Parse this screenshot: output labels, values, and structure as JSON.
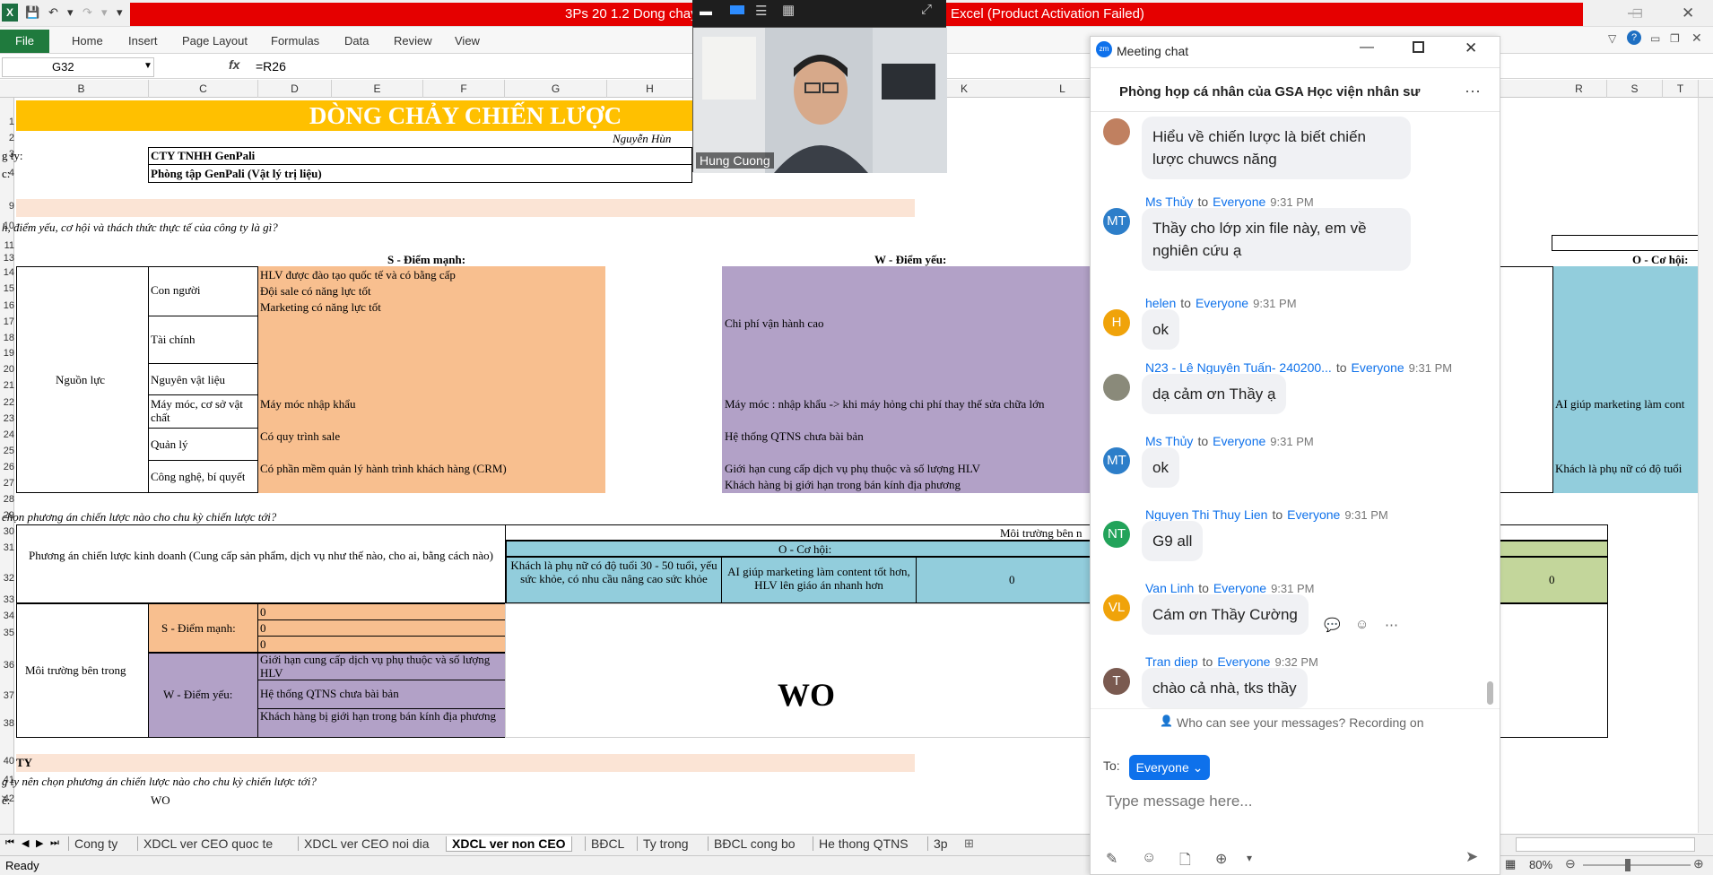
{
  "window": {
    "title": "3Ps 20 1.2 Dong chay chien luoc - Microsoft Excel (Product Activation Failed)",
    "title_left": "3Ps 20 1.2 Dong chay",
    "title_right": "Excel (Product Activation Failed)"
  },
  "ribbon": {
    "file": "File",
    "tabs": [
      "Home",
      "Insert",
      "Page Layout",
      "Formulas",
      "Data",
      "Review",
      "View"
    ]
  },
  "formula_bar": {
    "name_box": "G32",
    "fx": "fx",
    "formula": "=R26"
  },
  "columns": [
    "B",
    "C",
    "D",
    "E",
    "F",
    "G",
    "H",
    "K",
    "L",
    "R",
    "S",
    "T"
  ],
  "rows": [
    "1",
    "2",
    "3",
    "4",
    "9",
    "10",
    "11",
    "13",
    "14",
    "15",
    "16",
    "17",
    "18",
    "19",
    "20",
    "21",
    "22",
    "23",
    "24",
    "25",
    "26",
    "27",
    "28",
    "29",
    "30",
    "31",
    "32",
    "33",
    "34",
    "35",
    "36",
    "37",
    "38",
    "40",
    "41",
    "42"
  ],
  "sheet": {
    "banner": "DÒNG CHẢY CHIẾN LƯỢC",
    "author": "Nguyễn Hùn",
    "company_label": "g ty:",
    "company_value": "CTY TNHH GenPali",
    "unit_label": "c:",
    "unit_value": "Phòng tập GenPali (Vật lý trị liệu)",
    "q1": "h, điểm yếu, cơ hội và thách thức thực tế của công ty là gì?",
    "s_header": "S - Điểm mạnh:",
    "w_header": "W - Điểm yếu:",
    "o_header": "O - Cơ hội:",
    "resources": "Nguồn lực",
    "r_people": "Con người",
    "r_finance": "Tài chính",
    "r_material": "Nguyên vật liệu",
    "r_machine": "Máy móc, cơ sở vật chất",
    "r_manage": "Quản lý",
    "r_tech": "Công nghệ, bí quyết",
    "s1": "HLV được đào tạo quốc tế và có bằng cấp",
    "s2": "Đội sale có năng lực tốt",
    "s3": "Marketing có năng lực tốt",
    "s4": "Máy móc nhập khẩu",
    "s5": "Có quy trình sale",
    "s6": "Có phần mềm quản lý hành trình khách hàng (CRM)",
    "w1": "Chi phí vận hành cao",
    "w2": "Máy móc : nhập khẩu ->  khi máy hỏng chi phí thay thế sửa chữa lớn",
    "w3": "Hệ thống QTNS chưa bài bản",
    "w4": "Giới hạn cung cấp dịch vụ phụ thuộc và số lượng HLV",
    "w5": "Khách hàng bị giới hạn trong bán kính địa phương",
    "o1": "AI giúp marketing làm cont",
    "o2": "Khách là phụ nữ có độ tuổi",
    "q2": "chọn phương án chiến lược nào cho chu kỳ chiến lược tới?",
    "outer_env": "Môi trường bên n",
    "strategy_label": "Phương án chiến lược kinh doanh (Cung cấp sản phẩm, dịch vụ như thế nào, cho ai, bằng cách nào)",
    "o_sub": "O - Cơ hội:",
    "o_c1": "Khách là phụ nữ có độ tuổi 30 - 50 tuổi, yếu sức khỏe, có nhu cầu nâng cao sức khỏe",
    "o_c2": "AI giúp marketing làm content tốt hơn, HLV lên giáo án nhanh hơn",
    "o_c3": "0",
    "o_c4": "0",
    "inner_env": "Môi trường bên trong",
    "s_label": "S - Điểm mạnh:",
    "s_vals": [
      "0",
      "0",
      "0"
    ],
    "w_label": "W - Điểm yếu:",
    "w_vals": [
      "Giới hạn cung cấp dịch vụ phụ thuộc và số lượng HLV",
      "Hệ thống QTNS chưa bài bản",
      "Khách hàng bị giới hạn trong bán kính địa phương"
    ],
    "wo": "WO",
    "ty": "TY",
    "q3": "g ty nên chọn phương án chiến lược nào cho chu kỳ chiến lược tới?",
    "ans_label": "ề:",
    "ans_value": "WO"
  },
  "sheet_tabs": [
    "Cong ty",
    "XDCL ver CEO quoc te",
    "XDCL ver CEO noi dia",
    "XDCL ver non CEO",
    "BĐCL",
    "Ty trong",
    "BĐCL cong bo",
    "He thong QTNS",
    "3p"
  ],
  "active_tab": "XDCL ver non CEO",
  "status": {
    "ready": "Ready",
    "zoom": "80%"
  },
  "video": {
    "name": "Hung Cuong"
  },
  "chat": {
    "title": "Meeting chat",
    "room": "Phòng họp cá nhân của GSA Học viện nhân sư",
    "messages": [
      {
        "name": "",
        "to": "",
        "time": "",
        "text": "Hiểu về chiến lược là biết chiến lược chuwcs năng",
        "avatar": "",
        "color": "#c08060"
      },
      {
        "name": "Ms Thủy",
        "to": "Everyone",
        "time": "9:31 PM",
        "text": "Thầy cho lớp xin file này, em về nghiên cứu ạ",
        "avatar": "MT",
        "color": "#2d7ec9"
      },
      {
        "name": "helen",
        "to": "Everyone",
        "time": "9:31 PM",
        "text": "ok",
        "avatar": "H",
        "color": "#f0a30a"
      },
      {
        "name": "N23 - Lê Nguyên Tuấn- 240200...",
        "to": "Everyone",
        "time": "9:31 PM",
        "text": "dạ cảm ơn Thầy ạ",
        "avatar": "",
        "color": "#8a8a7a"
      },
      {
        "name": "Ms Thủy",
        "to": "Everyone",
        "time": "9:31 PM",
        "text": "ok",
        "avatar": "MT",
        "color": "#2d7ec9"
      },
      {
        "name": "Nguyen Thi Thuy Lien",
        "to": "Everyone",
        "time": "9:31 PM",
        "text": "G9 all",
        "avatar": "NT",
        "color": "#22a35a"
      },
      {
        "name": "Van Linh",
        "to": "Everyone",
        "time": "9:31 PM",
        "text": "Cám ơn Thầy Cường",
        "avatar": "VL",
        "color": "#f0a30a"
      },
      {
        "name": "Tran diep",
        "to": "Everyone",
        "time": "9:32 PM",
        "text": "chào cả nhà, tks thầy",
        "avatar": "T",
        "color": "#7a5a50"
      }
    ],
    "to_word": "to",
    "privacy": "Who can see your messages? Recording on",
    "to_label": "To:",
    "recipient": "Everyone",
    "placeholder": "Type message here..."
  }
}
